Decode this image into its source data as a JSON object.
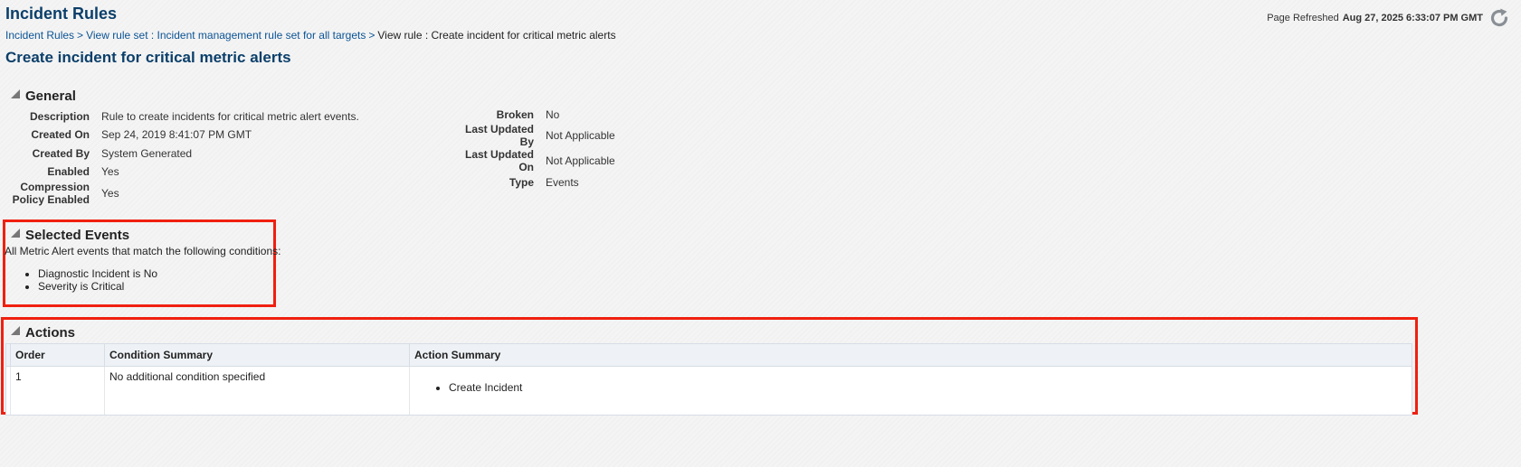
{
  "header": {
    "app_title": "Incident Rules",
    "refresh_label": "Page Refreshed",
    "refresh_timestamp": "Aug 27, 2025 6:33:07 PM GMT",
    "refresh_icon": "refresh-icon"
  },
  "breadcrumb": {
    "items": [
      "Incident Rules",
      "View rule set : Incident management rule set for all targets"
    ],
    "separator": ">",
    "current": "View rule : Create incident for critical metric alerts"
  },
  "page_title": "Create incident for critical metric alerts",
  "general": {
    "title": "General",
    "left": [
      {
        "label": "Description",
        "value": "Rule to create incidents for critical metric alert events."
      },
      {
        "label": "Created On",
        "value": "Sep 24, 2019 8:41:07 PM GMT"
      },
      {
        "label": "Created By",
        "value": "System Generated"
      },
      {
        "label": "Enabled",
        "value": "Yes"
      },
      {
        "label_line1": "Compression",
        "label_line2": "Policy Enabled",
        "value": "Yes"
      }
    ],
    "right": [
      {
        "label": "Broken",
        "value": "No"
      },
      {
        "label_line1": "Last Updated",
        "label_line2": "By",
        "value": "Not Applicable"
      },
      {
        "label_line1": "Last Updated",
        "label_line2": "On",
        "value": "Not Applicable"
      },
      {
        "label": "Type",
        "value": "Events"
      }
    ]
  },
  "selected_events": {
    "title": "Selected Events",
    "description": "All Metric Alert events that match the following conditions:",
    "conditions": [
      "Diagnostic Incident is No",
      "Severity is Critical"
    ]
  },
  "actions": {
    "title": "Actions",
    "columns": [
      "Order",
      "Condition Summary",
      "Action Summary"
    ],
    "rows": [
      {
        "order": "1",
        "condition": "No additional condition specified",
        "actions": [
          "Create Incident"
        ]
      }
    ]
  },
  "colors": {
    "title_blue": "#0b3f6a",
    "link_blue": "#0b5394",
    "highlight_red": "#f02010"
  }
}
